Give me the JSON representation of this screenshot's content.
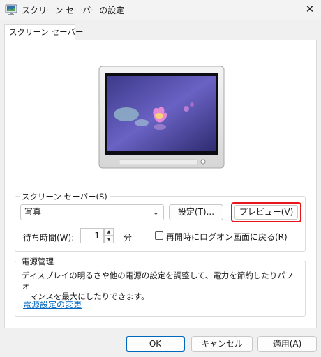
{
  "window": {
    "title": "スクリーン セーバーの設定",
    "close_glyph": "✕",
    "icon": "screensaver-monitor-icon"
  },
  "tab": {
    "label": "スクリーン セーバー"
  },
  "preview_image": {
    "description_icon": "water-lily-photo"
  },
  "screensaver": {
    "group_label": "スクリーン セーバー(S)",
    "selected": "写真",
    "settings_label": "設定(T)...",
    "preview_label": "プレビュー(V)",
    "wait_label": "待ち時間(W):",
    "wait_value": "1",
    "wait_unit": "分",
    "logon_label": "再開時にログオン画面に戻る(R)",
    "logon_checked": false
  },
  "power": {
    "group_label": "電源管理",
    "description_line1": "ディスプレイの明るさや他の電源の設定を調整して、電力を節約したりパフォ",
    "description_line2": "ーマンスを最大にしたりできます。",
    "link_label": "電源設定の変更"
  },
  "footer": {
    "ok_label": "OK",
    "cancel_label": "キャンセル",
    "apply_label": "適用(A)"
  },
  "colors": {
    "accent": "#0067c0",
    "highlight_box": "#e8151b"
  }
}
